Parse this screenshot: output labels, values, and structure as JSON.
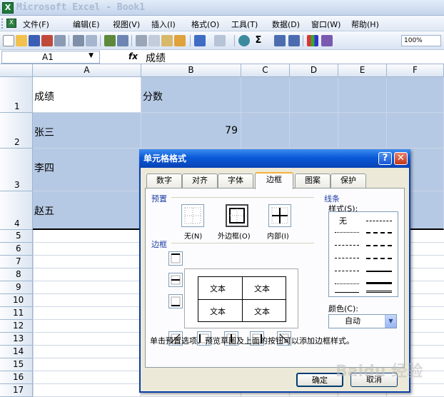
{
  "app": {
    "title": "Microsoft Excel - Book1"
  },
  "menu": [
    "文件(F)",
    "编辑(E)",
    "视图(V)",
    "插入(I)",
    "格式(O)",
    "工具(T)",
    "数据(D)",
    "窗口(W)",
    "帮助(H)"
  ],
  "toolbar": {
    "zoom": "100%",
    "sigma": "Σ"
  },
  "formula_bar": {
    "name_box": "A1",
    "fx": "fx",
    "value": "成绩"
  },
  "columns": [
    "A",
    "B",
    "C",
    "D",
    "E",
    "F"
  ],
  "rows": [
    "1",
    "2",
    "3",
    "4",
    "5",
    "6",
    "7",
    "8",
    "9",
    "10",
    "11",
    "12",
    "13",
    "14",
    "15",
    "16",
    "17"
  ],
  "cells": {
    "a1": "成绩",
    "b1": "分数",
    "a2": "张三",
    "b2": "79",
    "a3": "李四",
    "a4": "赵五"
  },
  "dialog": {
    "title": "单元格格式",
    "help": "?",
    "close": "✕",
    "tabs": [
      "数字",
      "对齐",
      "字体",
      "边框",
      "图案",
      "保护"
    ],
    "active_tab": "边框",
    "presets_label": "预置",
    "presets": [
      "无(N)",
      "外边框(O)",
      "内部(I)"
    ],
    "border_label": "边框",
    "line_label": "线条",
    "style_label": "样式(S):",
    "style_none": "无",
    "color_label": "颜色(C):",
    "color_value": "自动",
    "preview_text": [
      "文本",
      "文本",
      "文本",
      "文本"
    ],
    "hint": "单击预置选项、预览草图及上面的按钮可以添加边框样式。",
    "ok": "确定",
    "cancel": "取消"
  },
  "watermark": "Baidu 经验"
}
